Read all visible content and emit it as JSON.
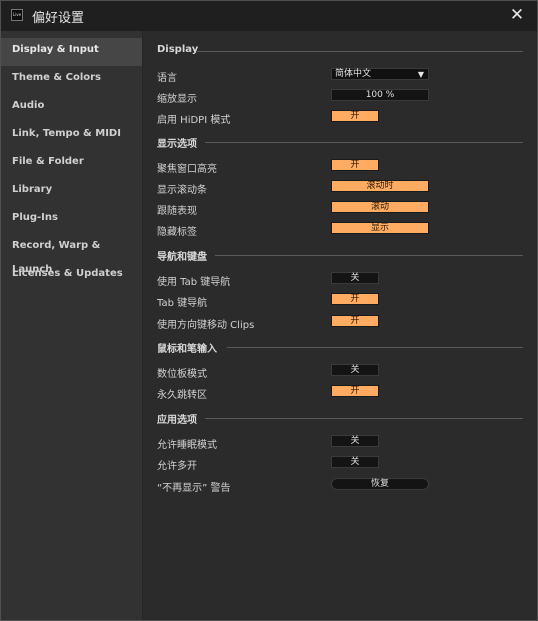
{
  "window": {
    "title": "偏好设置",
    "app_icon_text": "Live"
  },
  "sidebar": {
    "items": [
      {
        "label": "Display & Input",
        "active": true
      },
      {
        "label": "Theme & Colors"
      },
      {
        "label": "Audio"
      },
      {
        "label": "Link, Tempo & MIDI"
      },
      {
        "label": "File & Folder"
      },
      {
        "label": "Library"
      },
      {
        "label": "Plug-Ins"
      },
      {
        "label": "Record, Warp & Launch"
      },
      {
        "label": "Licenses & Updates"
      }
    ]
  },
  "sections": {
    "display": {
      "title": "Display",
      "language_label": "语言",
      "language_value": "简体中文",
      "zoom_label": "缩放显示",
      "zoom_value": "100 %",
      "hidpi_label": "启用 HiDPI 模式",
      "hidpi_value": "开"
    },
    "display_options": {
      "title": "显示选项",
      "focus_label": "聚焦窗口高亮",
      "focus_value": "开",
      "scrollbar_label": "显示滚动条",
      "scrollbar_value": "滚动时",
      "follow_label": "跟随表现",
      "follow_value": "滚动",
      "hide_labels_label": "隐藏标签",
      "hide_labels_value": "显示"
    },
    "nav_keyboard": {
      "title": "导航和键盘",
      "tab_nav_label": "使用 Tab 键导航",
      "tab_nav_value": "关",
      "tab_key_label": "Tab 键导航",
      "tab_key_value": "开",
      "arrow_clips_label": "使用方向键移动 Clips",
      "arrow_clips_value": "开"
    },
    "mouse_pen": {
      "title": "鼠标和笔输入",
      "tablet_label": "数位板模式",
      "tablet_value": "关",
      "jump_label": "永久跳转区",
      "jump_value": "开"
    },
    "app_options": {
      "title": "应用选项",
      "sleep_label": "允许睡眠模式",
      "sleep_value": "关",
      "multi_label": "允许多开",
      "multi_value": "关",
      "warning_label": "“不再显示” 警告",
      "warning_value": "恢复"
    }
  },
  "colors": {
    "accent": "#ffab61",
    "control_dark": "#141414"
  },
  "icons": {
    "close": "close-icon",
    "dropdown": "chevron-down-icon"
  }
}
